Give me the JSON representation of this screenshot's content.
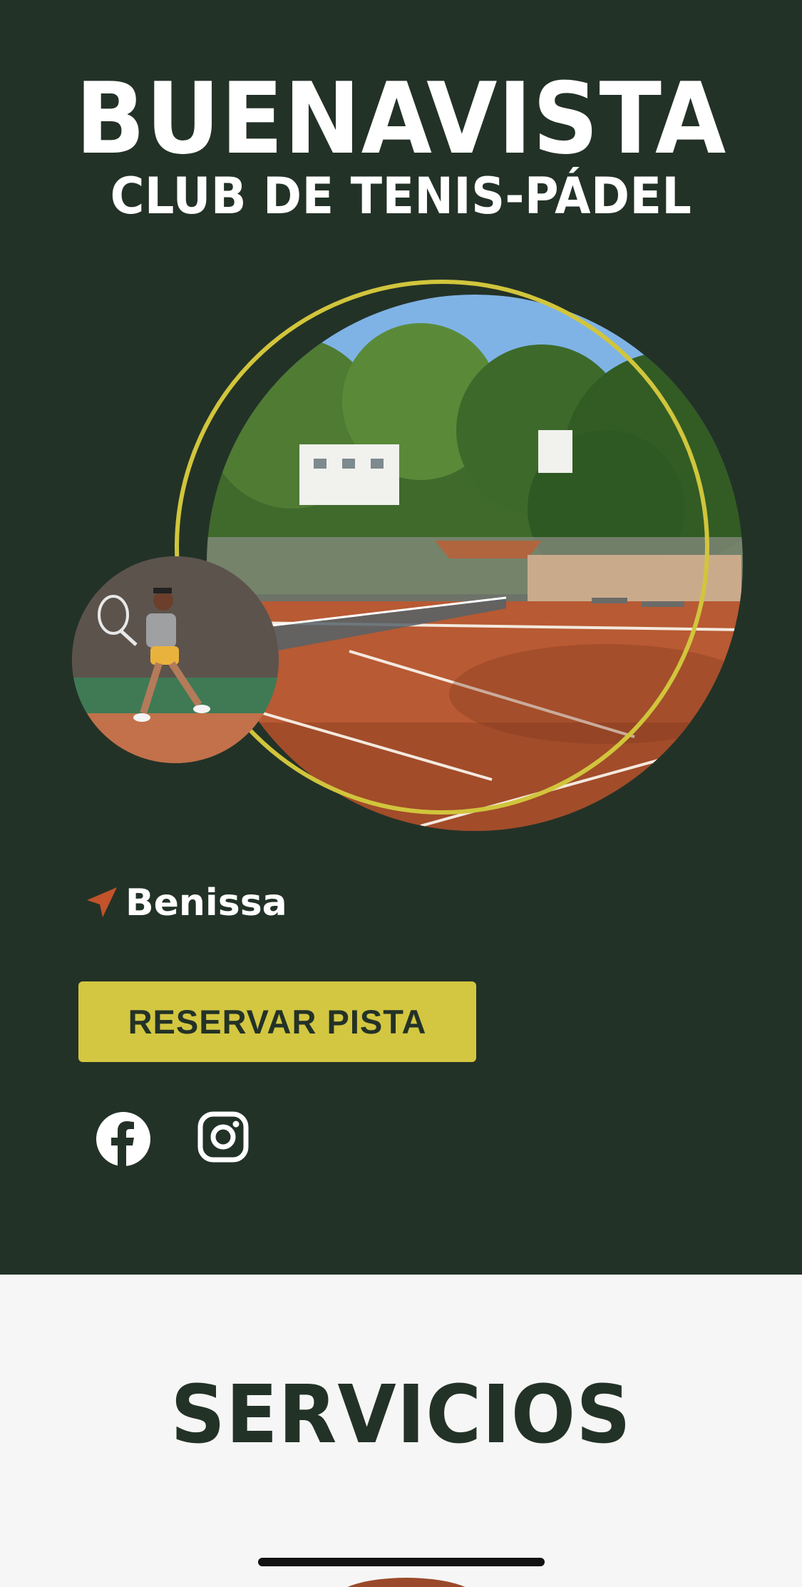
{
  "hero": {
    "title": "BUENAVISTA",
    "subtitle": "CLUB DE TENIS-PÁDEL",
    "court_image": "tennis-court-photo",
    "player_image": "tennis-player-photo"
  },
  "location": {
    "icon": "location-arrow-icon",
    "label": "Benissa"
  },
  "cta": {
    "reserve_label": "RESERVAR PISTA"
  },
  "social": {
    "facebook_icon": "facebook-icon",
    "instagram_icon": "instagram-icon"
  },
  "services": {
    "title": "SERVICIOS"
  },
  "colors": {
    "hero_bg": "#233227",
    "accent": "#d3c741",
    "location_icon": "#c2532a",
    "page_bg": "#f6f6f6"
  }
}
